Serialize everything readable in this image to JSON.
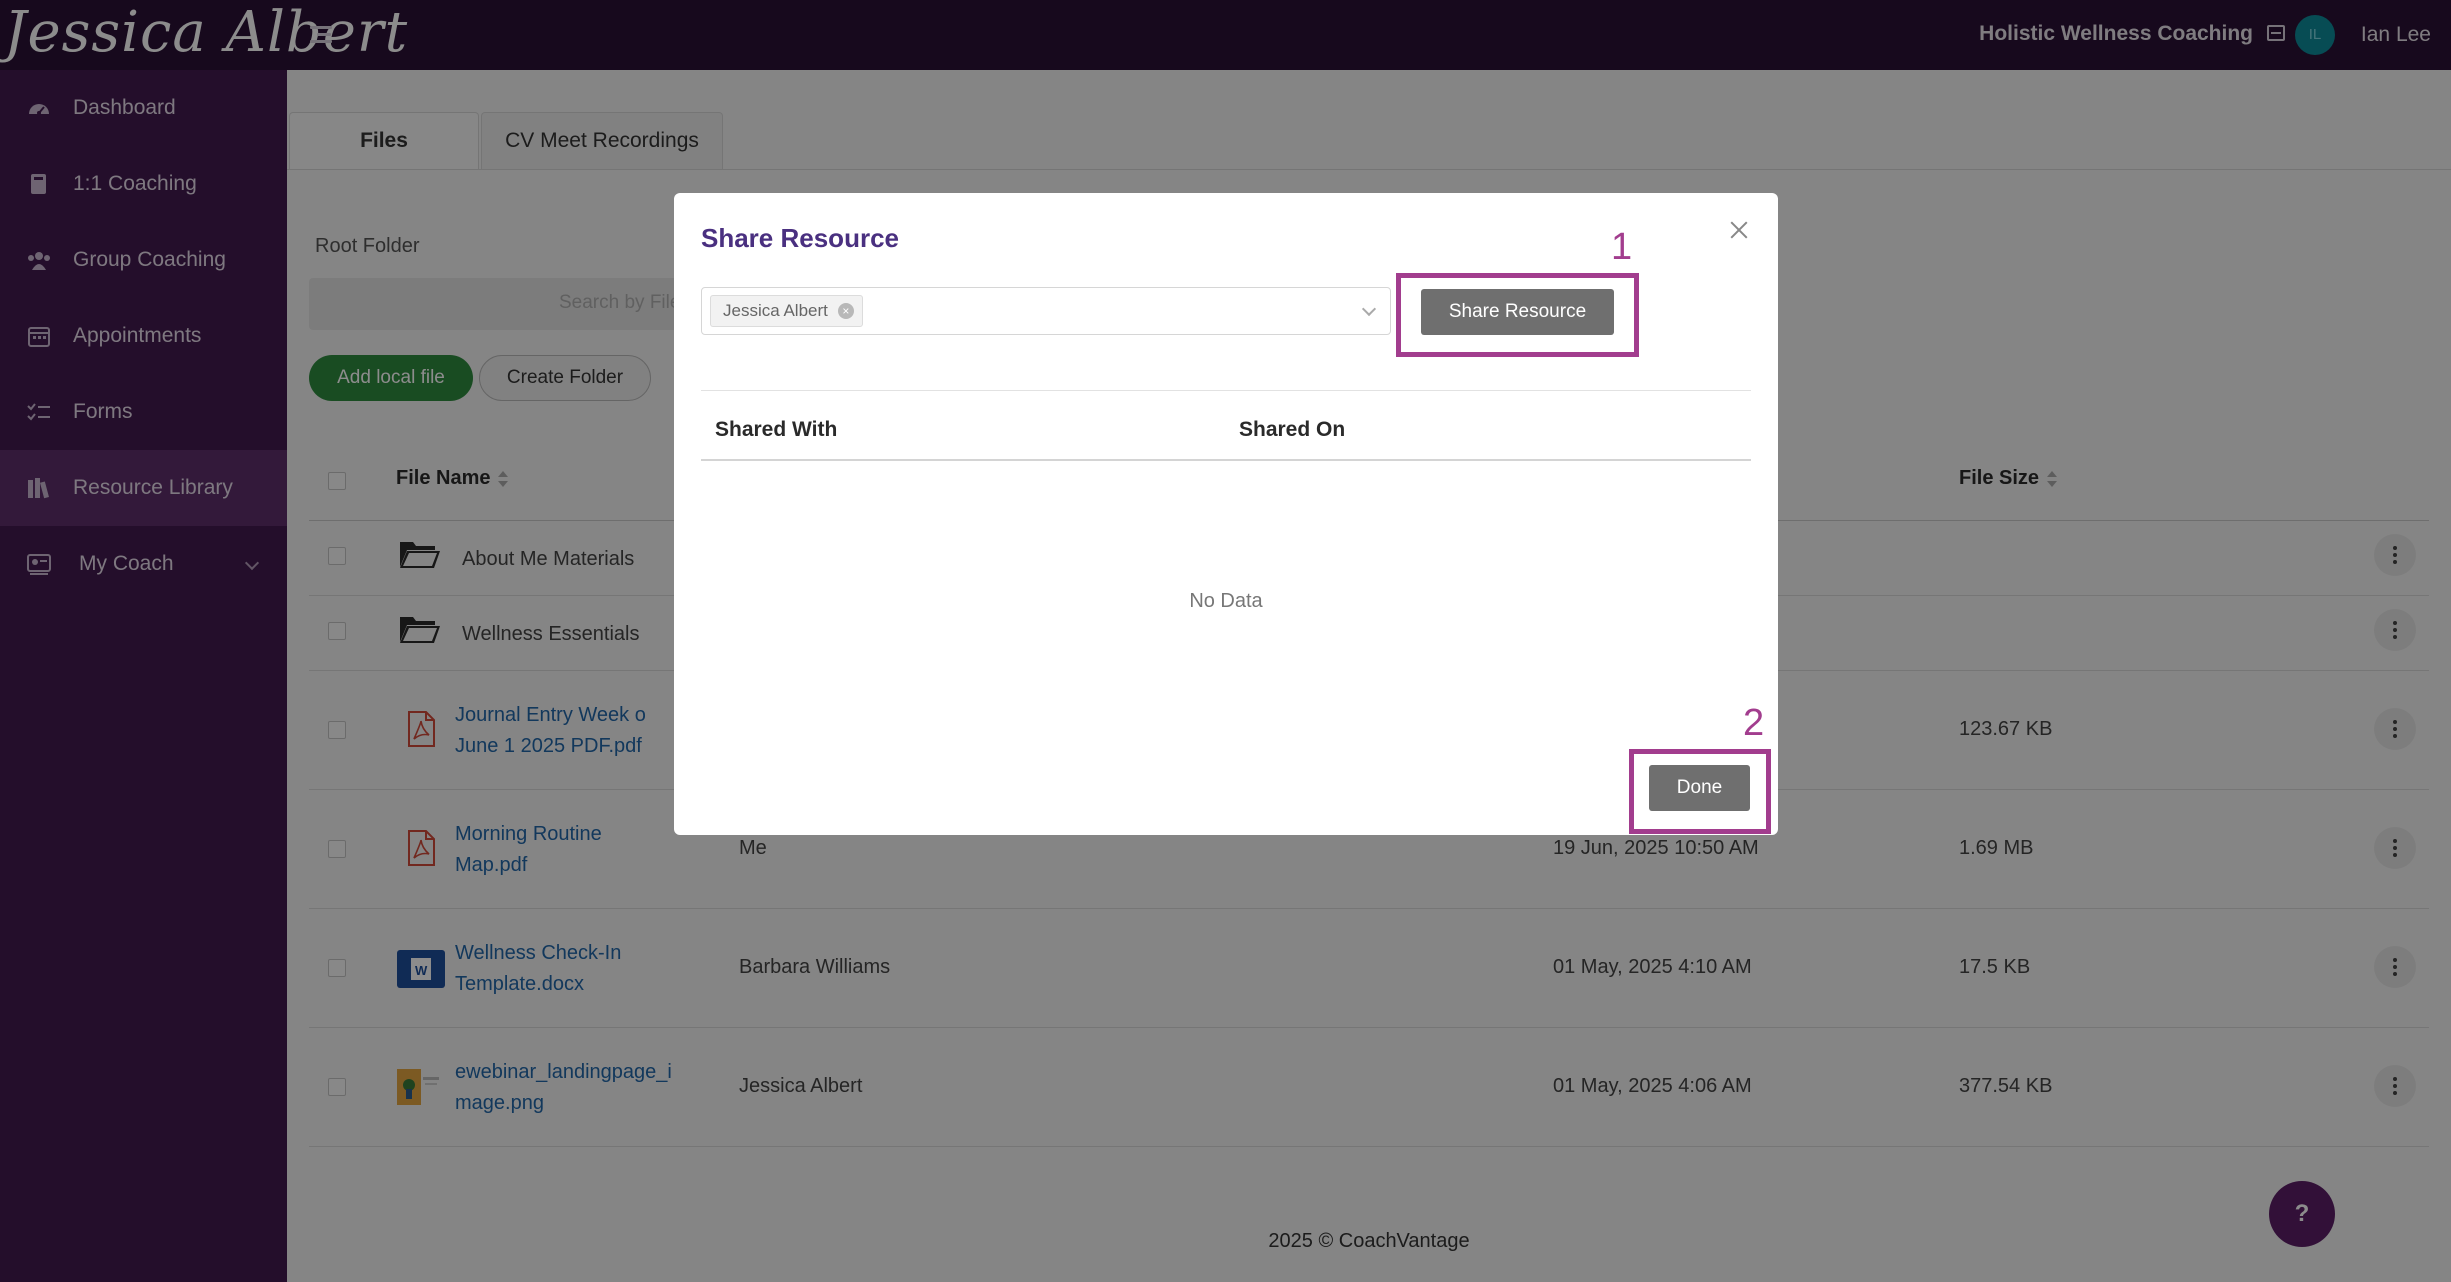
{
  "header": {
    "logo_text": "Jessica Albert",
    "org_name": "Holistic Wellness Coaching",
    "avatar_initials": "IL",
    "user_name": "Ian Lee"
  },
  "sidebar": {
    "items": [
      {
        "label": "Dashboard",
        "icon": "dashboard-icon"
      },
      {
        "label": "1:1 Coaching",
        "icon": "book-icon"
      },
      {
        "label": "Group Coaching",
        "icon": "group-icon"
      },
      {
        "label": "Appointments",
        "icon": "calendar-icon"
      },
      {
        "label": "Forms",
        "icon": "checklist-icon"
      },
      {
        "label": "Resource Library",
        "icon": "library-icon",
        "active": true
      },
      {
        "label": "My Coach",
        "icon": "coach-icon"
      }
    ]
  },
  "main": {
    "tabs": [
      {
        "label": "Files",
        "active": true
      },
      {
        "label": "CV Meet Recordings"
      }
    ],
    "root_folder": "Root Folder",
    "search_placeholder": "Search by File N",
    "add_local_file": "Add local file",
    "create_folder": "Create Folder",
    "columns": {
      "file_name": "File Name",
      "file_size": "File Size"
    },
    "rows": [
      {
        "type": "folder",
        "name": "About Me Materials",
        "owner": "",
        "date": "",
        "size": ""
      },
      {
        "type": "folder",
        "name": "Wellness Essentials",
        "owner": "",
        "date": "",
        "size": ""
      },
      {
        "type": "pdf",
        "name_line1": "Journal Entry Week o",
        "name_line2": "June 1 2025 PDF.pdf",
        "owner": "",
        "date": "",
        "size": "123.67 KB"
      },
      {
        "type": "pdf",
        "name_line1": "Morning Routine",
        "name_line2": "Map.pdf",
        "owner": "Me",
        "date": "19 Jun, 2025 10:50 AM",
        "size": "1.69 MB"
      },
      {
        "type": "word",
        "name_line1": "Wellness Check-In",
        "name_line2": "Template.docx",
        "owner": "Barbara Williams",
        "date": "01 May, 2025 4:10 AM",
        "size": "17.5 KB"
      },
      {
        "type": "image",
        "name_line1": "ewebinar_landingpage_i",
        "name_line2": "mage.png",
        "owner": "Jessica Albert",
        "date": "01 May, 2025 4:06 AM",
        "size": "377.54 KB"
      }
    ],
    "footer": "2025 © CoachVantage",
    "help_label": "?"
  },
  "modal": {
    "title": "Share Resource",
    "selected_chip": "Jessica Albert",
    "share_button": "Share Resource",
    "columns": {
      "shared_with": "Shared With",
      "shared_on": "Shared On"
    },
    "empty_text": "No Data",
    "done_button": "Done"
  },
  "callouts": {
    "one": "1",
    "two": "2"
  },
  "colors": {
    "topbar": "#2b1236",
    "sidebar": "#421a4f",
    "accent_purple": "#4a3080",
    "callout": "#a23d8e",
    "add_button_green": "#2f8a3f",
    "link_blue": "#2266a8"
  }
}
